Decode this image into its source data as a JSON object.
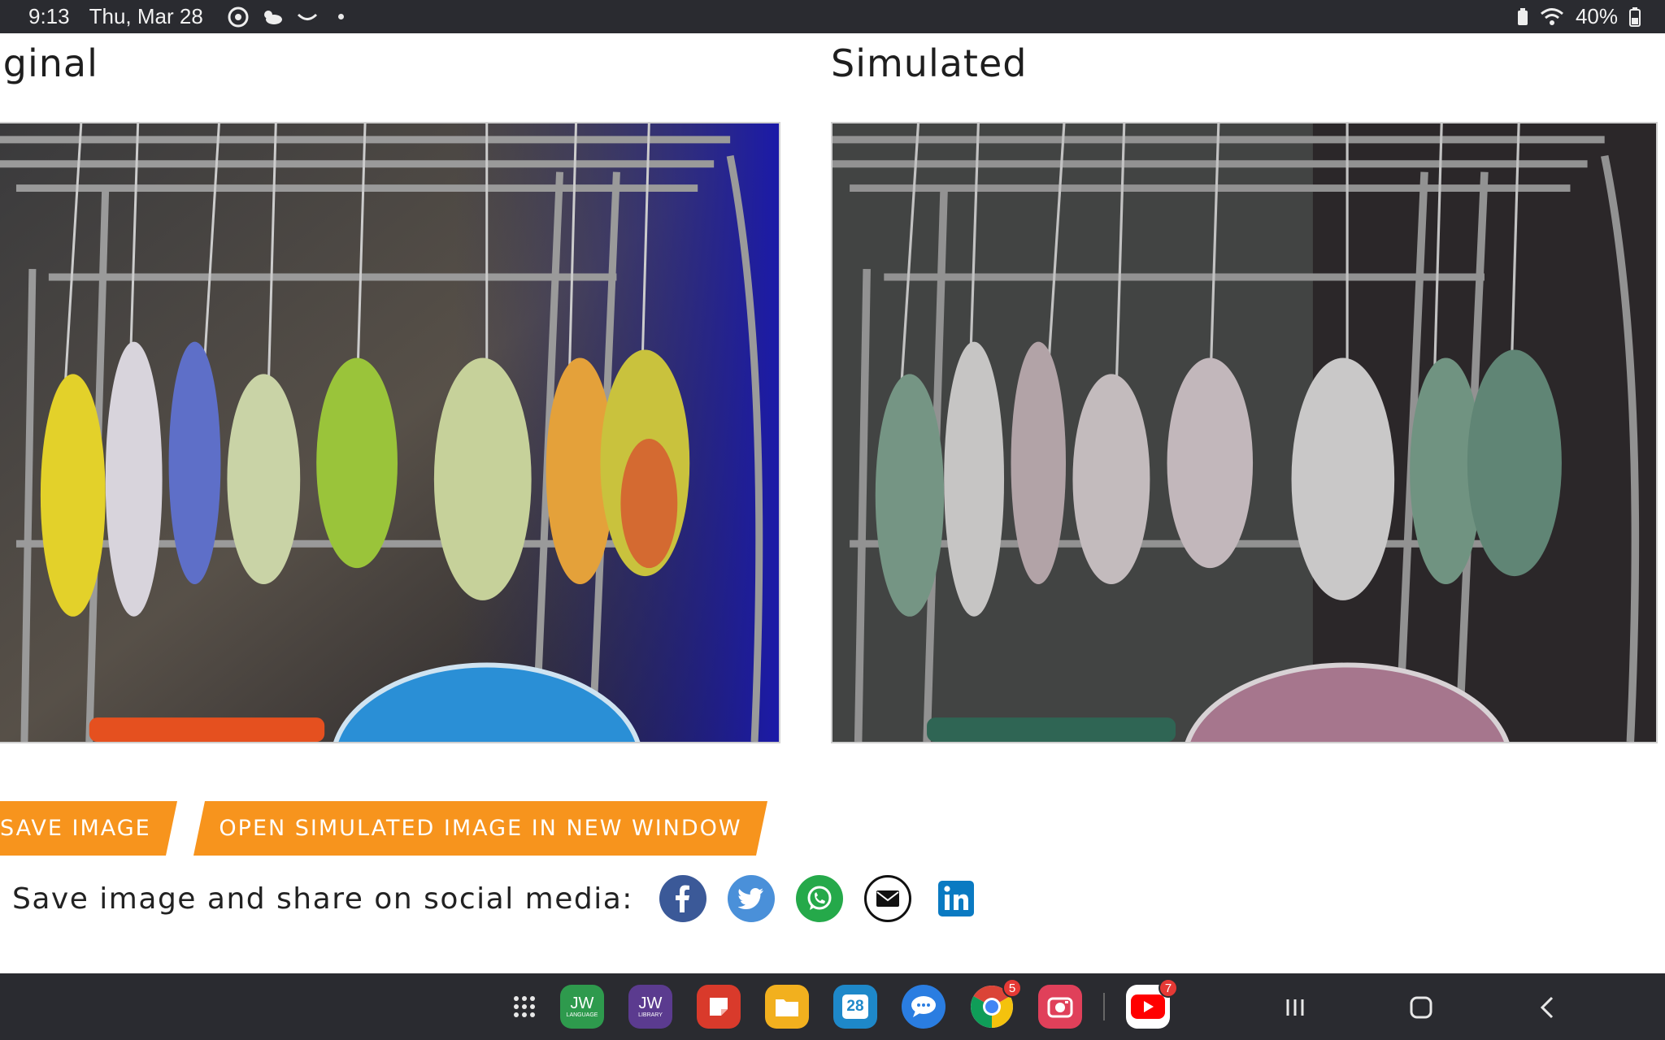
{
  "status_bar": {
    "time": "9:13",
    "date": "Thu, Mar 28",
    "icons": [
      "chrome-icon",
      "weather-icon",
      "smile-icon",
      "notification-dot"
    ],
    "battery": "40%"
  },
  "headings": {
    "original": "iginal",
    "simulated": "Simulated"
  },
  "buttons": {
    "save_image": "SAVE IMAGE",
    "open_simulated": "OPEN SIMULATED IMAGE IN NEW WINDOW"
  },
  "share": {
    "label": "Save image and share on social media:",
    "networks": [
      "facebook",
      "twitter",
      "whatsapp",
      "email",
      "linkedin"
    ]
  },
  "dock": {
    "apps": [
      {
        "name": "JW Language",
        "label": "JW",
        "sub": "LANGUAGE",
        "color": "#2e9a4d"
      },
      {
        "name": "JW Library",
        "label": "JW",
        "sub": "LIBRARY",
        "color": "#5b3b8f"
      },
      {
        "name": "Notes",
        "label": "",
        "color": "#d93a2b"
      },
      {
        "name": "My Files",
        "label": "",
        "color": "#f2b01e"
      },
      {
        "name": "Calendar",
        "label": "28",
        "color": "#1e88c9"
      },
      {
        "name": "Messages",
        "label": "",
        "color": "#2a7de1"
      },
      {
        "name": "Chrome",
        "badge": "5"
      },
      {
        "name": "Screen Recorder",
        "color": "#e0405a"
      },
      {
        "name": "YouTube",
        "badge": "7"
      }
    ]
  },
  "colors": {
    "accent_orange": "#f7941d",
    "bar_dark": "#2a2b30"
  }
}
